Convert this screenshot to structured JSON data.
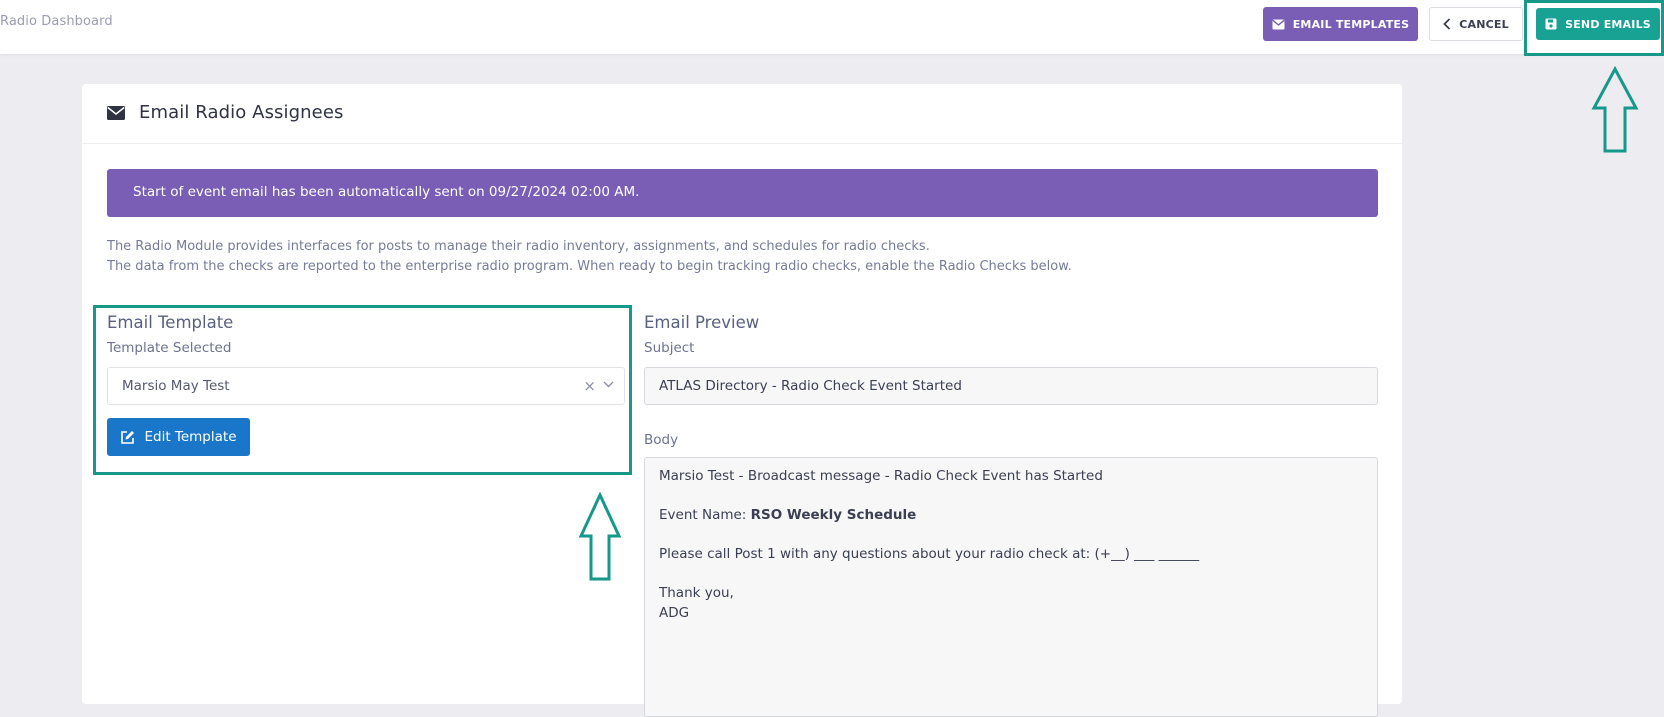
{
  "topbar": {
    "breadcrumb": "Radio Dashboard",
    "email_templates_label": "EMAIL TEMPLATES",
    "cancel_label": "CANCEL",
    "send_emails_label": "SEND EMAILS"
  },
  "card": {
    "title": "Email Radio Assignees",
    "alert": "Start of event email has been automatically sent on 09/27/2024 02:00 AM.",
    "description_line1": "The Radio Module provides interfaces for posts to manage their radio inventory, assignments, and schedules for radio checks.",
    "description_line2": "The data from the checks are reported to the enterprise radio program. When ready to begin tracking radio checks, enable the Radio Checks below."
  },
  "template_section": {
    "title": "Email Template",
    "label": "Template Selected",
    "selected_value": "Marsio May Test",
    "edit_label": "Edit Template"
  },
  "preview_section": {
    "title": "Email Preview",
    "subject_label": "Subject",
    "subject_value": "ATLAS Directory - Radio Check Event Started",
    "body_label": "Body",
    "body": {
      "line1": "Marsio Test - Broadcast message - Radio Check Event has Started",
      "event_prefix": "Event Name: ",
      "event_name": "RSO Weekly Schedule",
      "line3": "Please call Post 1 with any questions about your radio check at: (+__) ___ ______",
      "line4": "Thank you,",
      "line5": "ADG"
    }
  },
  "colors": {
    "purple": "#7a5db4",
    "teal": "#17a294",
    "blue": "#1a76c8",
    "highlight": "#16988a"
  }
}
